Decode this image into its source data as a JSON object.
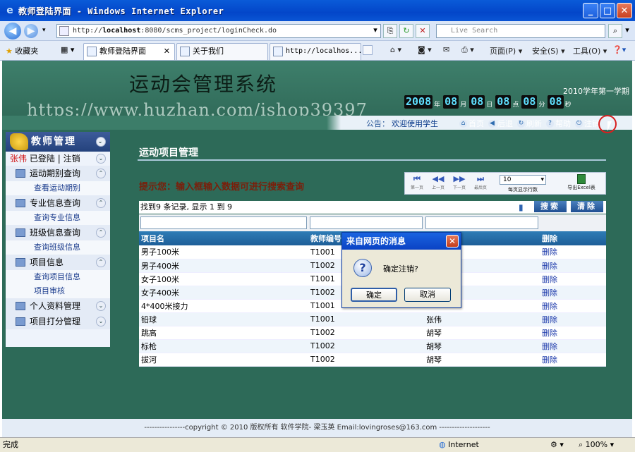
{
  "window": {
    "title": "教师登陆界面 - Windows Internet Explorer"
  },
  "browser": {
    "url_prefix": "http://",
    "url_host": "localhost",
    "url_rest": ":8080/scms_project/loginCheck.do",
    "search_placeholder": "Live Search",
    "favorites_label": "收藏夹",
    "tabs": [
      {
        "label": "教师登陆界面"
      },
      {
        "label": "关于我们"
      },
      {
        "label": "http://localhos..."
      }
    ],
    "toolbar": {
      "page": "页面(P)",
      "safety": "安全(S)",
      "tools": "工具(O)"
    }
  },
  "header": {
    "app_title": "运动会管理系统",
    "watermark": "https://www.huzhan.com/ishop39397",
    "semester": "2010学年第一学期",
    "clock": [
      {
        "digits": "2008",
        "unit": "年"
      },
      {
        "digits": "08",
        "unit": "月"
      },
      {
        "digits": "08",
        "unit": "日"
      },
      {
        "digits": "08",
        "unit": "点"
      },
      {
        "digits": "08",
        "unit": "分"
      },
      {
        "digits": "08",
        "unit": "秒"
      }
    ]
  },
  "notice": {
    "label": "公告：",
    "message": "欢迎使用学生",
    "links": [
      {
        "label": "首页",
        "icon": "home-icon"
      },
      {
        "label": "后退",
        "icon": "back-icon"
      },
      {
        "label": "刷新",
        "icon": "refresh-icon"
      },
      {
        "label": "帮助",
        "icon": "help-icon"
      },
      {
        "label": "注销",
        "icon": "logout-icon"
      }
    ]
  },
  "sidebar": {
    "title": "教师管理",
    "user_name": "张伟",
    "user_status": "已登陆",
    "user_sep": "|",
    "user_logout": "注销",
    "groups": [
      {
        "label": "运动期别查询",
        "chev": "⌃",
        "subs": [
          "查看运动期别"
        ]
      },
      {
        "label": "专业信息查询",
        "chev": "⌃",
        "subs": [
          "查询专业信息"
        ]
      },
      {
        "label": "班级信息查询",
        "chev": "⌃",
        "subs": [
          "查询班级信息"
        ]
      },
      {
        "label": "项目信息",
        "chev": "⌃",
        "subs": [
          "查询项目信息",
          "项目审核"
        ]
      },
      {
        "label": "个人资料管理",
        "chev": "⌄",
        "subs": []
      },
      {
        "label": "项目打分管理",
        "chev": "⌄",
        "subs": []
      }
    ]
  },
  "main": {
    "page_title": "运动项目管理",
    "hint": "提示您：输入框输入数据可进行搜索查询",
    "pager": {
      "first": "第一页",
      "prev": "上一页",
      "next": "下一页",
      "last": "最后页",
      "rows_value": "10",
      "rows_label": "每页显示行数",
      "export_label": "导出Excel表"
    },
    "found_text": "找到9 条记录, 显示 1 到 9",
    "search_label": "搜索",
    "clear_label": "清除",
    "columns": [
      "项目名",
      "教师编号",
      "",
      "删除"
    ],
    "rows": [
      {
        "name": "男子100米",
        "teacher": "T1001",
        "third": "",
        "del": "删除"
      },
      {
        "name": "男子400米",
        "teacher": "T1002",
        "third": "",
        "del": "删除"
      },
      {
        "name": "女子100米",
        "teacher": "T1001",
        "third": "",
        "del": "删除"
      },
      {
        "name": "女子400米",
        "teacher": "T1002",
        "third": "",
        "del": "删除"
      },
      {
        "name": "4*400米接力",
        "teacher": "T1001",
        "third": "",
        "del": "删除"
      },
      {
        "name": "铅球",
        "teacher": "T1001",
        "third": "张伟",
        "del": "删除"
      },
      {
        "name": "跳高",
        "teacher": "T1002",
        "third": "胡琴",
        "del": "删除"
      },
      {
        "name": "标枪",
        "teacher": "T1002",
        "third": "胡琴",
        "del": "删除"
      },
      {
        "name": "拔河",
        "teacher": "T1002",
        "third": "胡琴",
        "del": "删除"
      }
    ]
  },
  "footer": {
    "text": "----------------copyright © 2010 版权所有 软件学院- 梁玉英  Email:lovingroses@163.com --------------------"
  },
  "dialog": {
    "title": "来自网页的消息",
    "message": "确定注销?",
    "ok_label": "确定",
    "cancel_label": "取消"
  },
  "status": {
    "left": "完成",
    "zone": "Internet",
    "zoom": "100%"
  }
}
